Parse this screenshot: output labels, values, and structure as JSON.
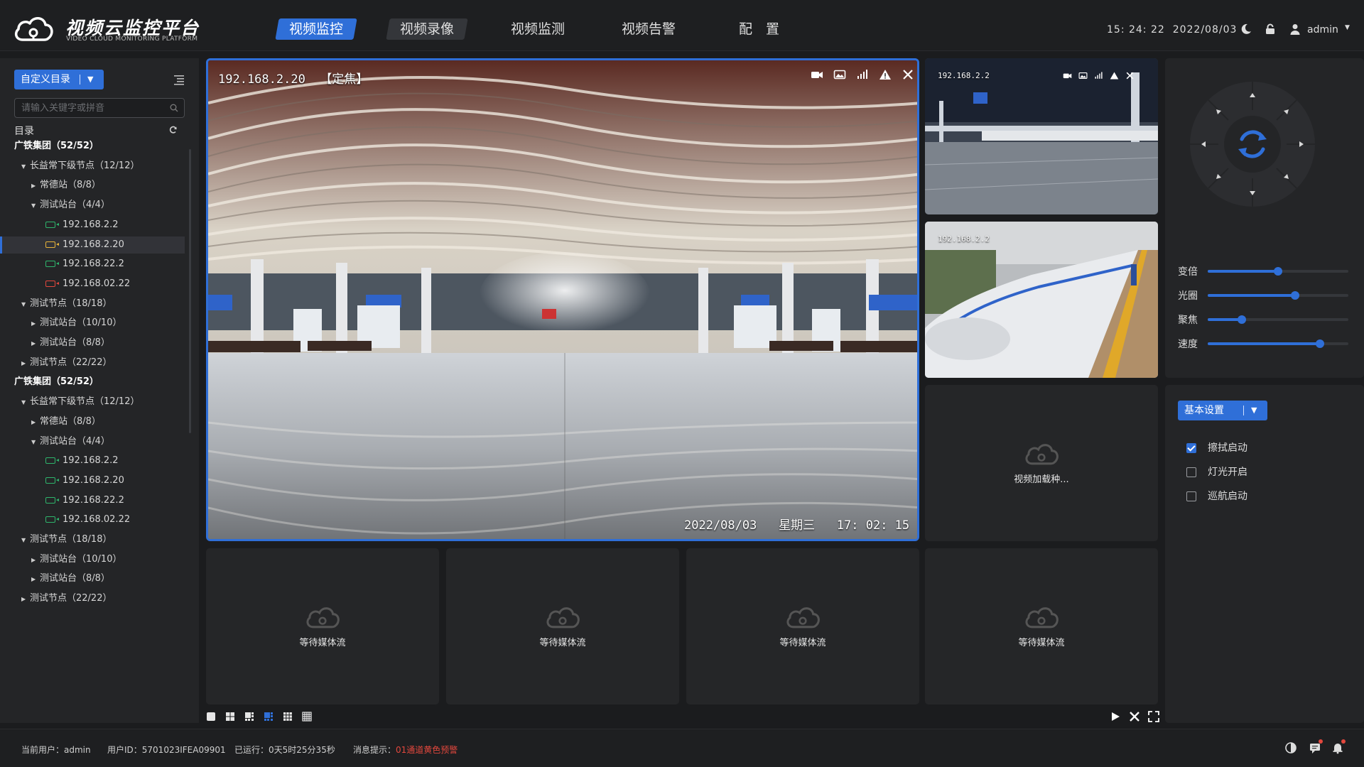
{
  "header": {
    "title": "视频云监控平台",
    "subtitle": "VIDEO CLOUD MONITORING PLATFORM",
    "tabs": [
      "视频监控",
      "视频录像",
      "视频监测",
      "视频告警",
      "配　置"
    ],
    "active_tab": "视频监控",
    "time": "15: 24: 22",
    "date": "2022/08/03",
    "user": "admin"
  },
  "sidebar": {
    "dir_button": "自定义目录",
    "search_placeholder": "请输入关键字或拼音",
    "dir_label": "目录",
    "tree": [
      {
        "label": "广铁集团（52/52）",
        "level": 0
      },
      {
        "label": "长益常下级节点（12/12）",
        "level": 1,
        "arrow": "down"
      },
      {
        "label": "常德站（8/8）",
        "level": 2,
        "arrow": "right"
      },
      {
        "label": "测试站台（4/4）",
        "level": 2,
        "arrow": "down"
      },
      {
        "label": "192.168.2.2",
        "level": 3,
        "status": "green"
      },
      {
        "label": "192.168.2.20",
        "level": 3,
        "status": "yellow",
        "selected": true
      },
      {
        "label": "192.168.22.2",
        "level": 3,
        "status": "green"
      },
      {
        "label": "192.168.02.22",
        "level": 3,
        "status": "red"
      },
      {
        "label": "测试节点（18/18）",
        "level": 1,
        "arrow": "down"
      },
      {
        "label": "测试站台（10/10）",
        "level": 2,
        "arrow": "right"
      },
      {
        "label": "测试站台（8/8）",
        "level": 2,
        "arrow": "right"
      },
      {
        "label": "测试节点（22/22）",
        "level": 1,
        "arrow": "right"
      },
      {
        "label": "广铁集团（52/52）",
        "level": 0
      },
      {
        "label": "长益常下级节点（12/12）",
        "level": 1,
        "arrow": "down"
      },
      {
        "label": "常德站（8/8）",
        "level": 2,
        "arrow": "right"
      },
      {
        "label": "测试站台（4/4）",
        "level": 2,
        "arrow": "down"
      },
      {
        "label": "192.168.2.2",
        "level": 3,
        "status": "green"
      },
      {
        "label": "192.168.2.20",
        "level": 3,
        "status": "green"
      },
      {
        "label": "192.168.22.2",
        "level": 3,
        "status": "green"
      },
      {
        "label": "192.168.02.22",
        "level": 3,
        "status": "green"
      },
      {
        "label": "测试节点（18/18）",
        "level": 1,
        "arrow": "down"
      },
      {
        "label": "测试站台（10/10）",
        "level": 2,
        "arrow": "right"
      },
      {
        "label": "测试站台（8/8）",
        "level": 2,
        "arrow": "right"
      },
      {
        "label": "测试节点（22/22）",
        "level": 1,
        "arrow": "right"
      }
    ]
  },
  "main_video": {
    "camera": "192.168.2.20",
    "mode": "【定焦】",
    "date": "2022/08/03",
    "weekday": "星期三",
    "time": "17: 02: 15"
  },
  "thumbs": [
    {
      "camera": "192.168.2.2"
    },
    {
      "camera": "192.168.2.2"
    }
  ],
  "loading_text": "视频加载种...",
  "waiting_text": "等待媒体流",
  "ptz": {
    "sliders": [
      {
        "label": "变倍",
        "value": 0.5
      },
      {
        "label": "光圈",
        "value": 0.62
      },
      {
        "label": "聚焦",
        "value": 0.24
      },
      {
        "label": "速度",
        "value": 0.8
      }
    ]
  },
  "settings": {
    "button": "基本设置",
    "options": [
      {
        "label": "擦拭启动",
        "checked": true
      },
      {
        "label": "灯光开启",
        "checked": false
      },
      {
        "label": "巡航启动",
        "checked": false
      }
    ]
  },
  "status": {
    "user_label": "当前用户：",
    "user": "admin",
    "uid_label": "用户ID：",
    "uid": "5701023IFEA09901",
    "run_label": "已运行：",
    "run": "0天5时25分35秒",
    "msg_label": "消息提示：",
    "msg": "01通道黄色预警"
  },
  "colors": {
    "accent": "#2f6fd8",
    "background": "#1b1c1e",
    "panel": "#242527",
    "status_green": "#2eb56c",
    "status_yellow": "#e8b43a",
    "status_red": "#e2473d"
  }
}
